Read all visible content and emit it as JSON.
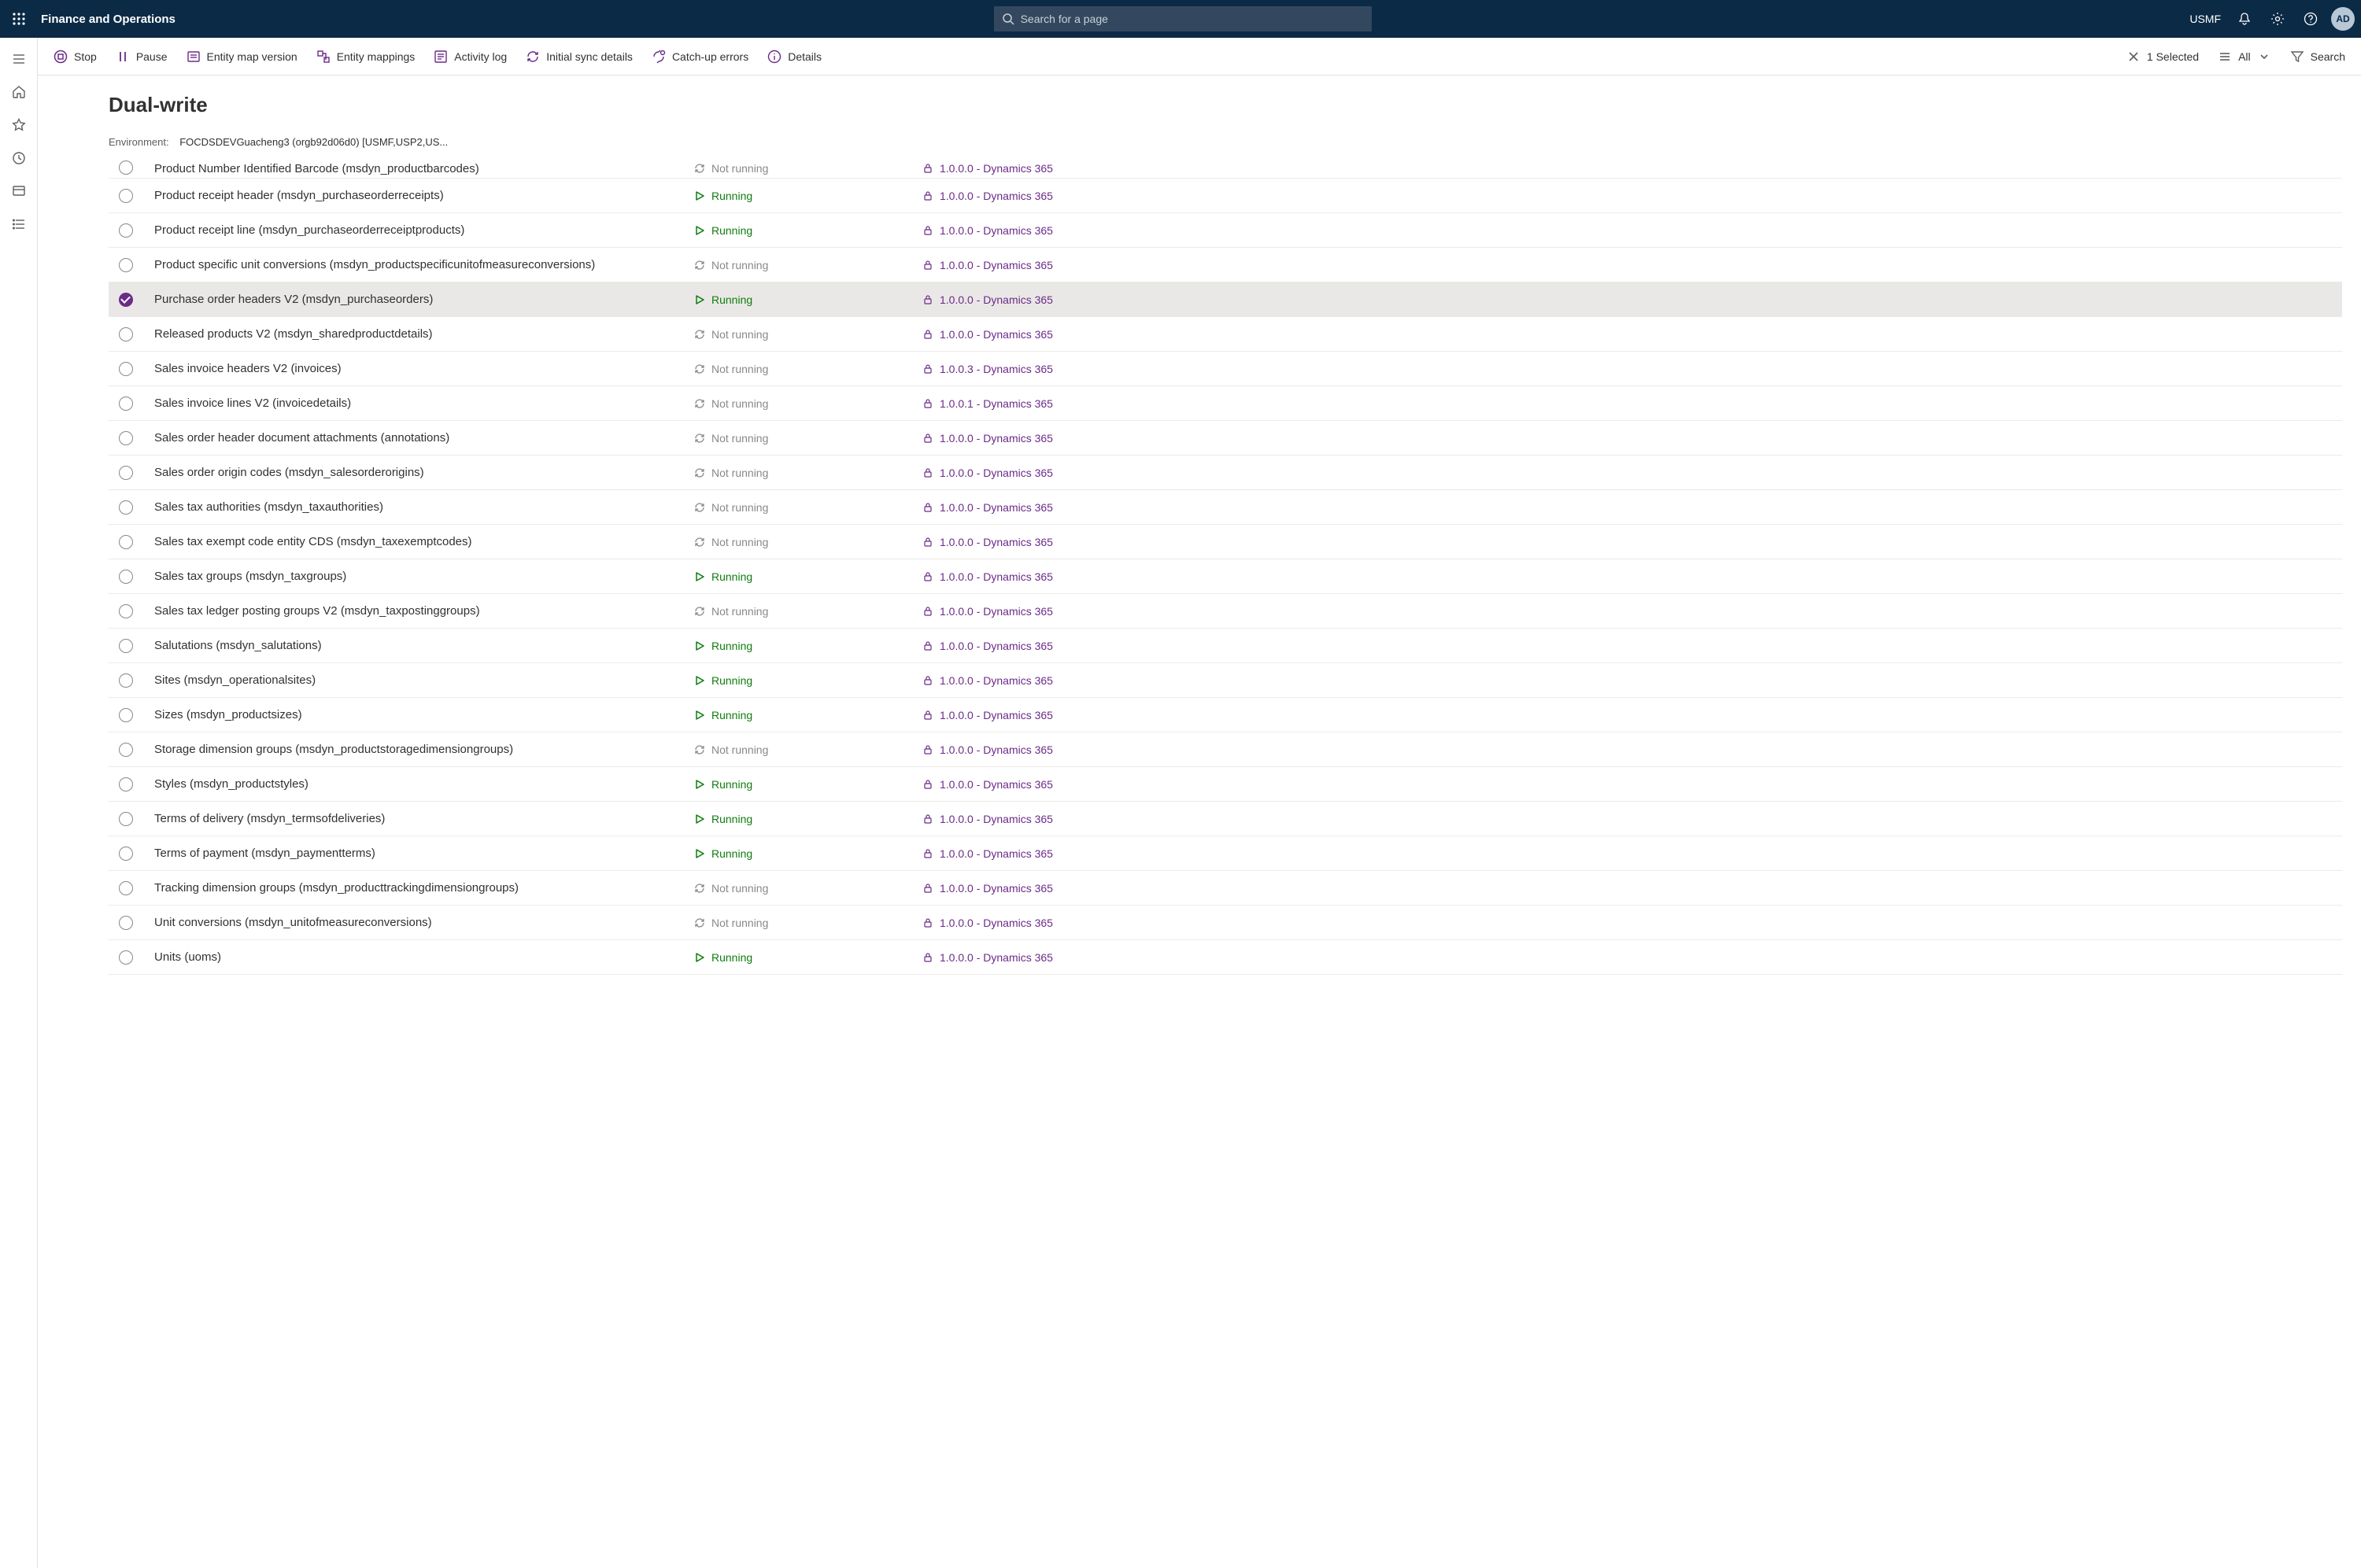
{
  "topbar": {
    "app_title": "Finance and Operations",
    "search_placeholder": "Search for a page",
    "company": "USMF",
    "avatar_initials": "AD"
  },
  "commands": {
    "stop": "Stop",
    "pause": "Pause",
    "entity_map_version": "Entity map version",
    "entity_mappings": "Entity mappings",
    "activity_log": "Activity log",
    "initial_sync_details": "Initial sync details",
    "catchup_errors": "Catch-up errors",
    "details": "Details",
    "selected": "1 Selected",
    "all": "All",
    "search": "Search"
  },
  "page": {
    "title": "Dual-write",
    "env_label": "Environment:",
    "env_value": "FOCDSDEVGuacheng3 (orgb92d06d0) [USMF,USP2,US..."
  },
  "status_labels": {
    "running": "Running",
    "notrunning": "Not running"
  },
  "rows": [
    {
      "name": "Product Number Identified Barcode (msdyn_productbarcodes)",
      "status": "notrunning",
      "version": "1.0.0.0 - Dynamics 365",
      "selected": false,
      "clipped": true
    },
    {
      "name": "Product receipt header (msdyn_purchaseorderreceipts)",
      "status": "running",
      "version": "1.0.0.0 - Dynamics 365",
      "selected": false
    },
    {
      "name": "Product receipt line (msdyn_purchaseorderreceiptproducts)",
      "status": "running",
      "version": "1.0.0.0 - Dynamics 365",
      "selected": false
    },
    {
      "name": "Product specific unit conversions (msdyn_productspecificunitofmeasureconversions)",
      "status": "notrunning",
      "version": "1.0.0.0 - Dynamics 365",
      "selected": false
    },
    {
      "name": "Purchase order headers V2 (msdyn_purchaseorders)",
      "status": "running",
      "version": "1.0.0.0 - Dynamics 365",
      "selected": true
    },
    {
      "name": "Released products V2 (msdyn_sharedproductdetails)",
      "status": "notrunning",
      "version": "1.0.0.0 - Dynamics 365",
      "selected": false
    },
    {
      "name": "Sales invoice headers V2 (invoices)",
      "status": "notrunning",
      "version": "1.0.0.3 - Dynamics 365",
      "selected": false
    },
    {
      "name": "Sales invoice lines V2 (invoicedetails)",
      "status": "notrunning",
      "version": "1.0.0.1 - Dynamics 365",
      "selected": false
    },
    {
      "name": "Sales order header document attachments (annotations)",
      "status": "notrunning",
      "version": "1.0.0.0 - Dynamics 365",
      "selected": false
    },
    {
      "name": "Sales order origin codes (msdyn_salesorderorigins)",
      "status": "notrunning",
      "version": "1.0.0.0 - Dynamics 365",
      "selected": false
    },
    {
      "name": "Sales tax authorities (msdyn_taxauthorities)",
      "status": "notrunning",
      "version": "1.0.0.0 - Dynamics 365",
      "selected": false
    },
    {
      "name": "Sales tax exempt code entity CDS (msdyn_taxexemptcodes)",
      "status": "notrunning",
      "version": "1.0.0.0 - Dynamics 365",
      "selected": false
    },
    {
      "name": "Sales tax groups (msdyn_taxgroups)",
      "status": "running",
      "version": "1.0.0.0 - Dynamics 365",
      "selected": false
    },
    {
      "name": "Sales tax ledger posting groups V2 (msdyn_taxpostinggroups)",
      "status": "notrunning",
      "version": "1.0.0.0 - Dynamics 365",
      "selected": false
    },
    {
      "name": "Salutations (msdyn_salutations)",
      "status": "running",
      "version": "1.0.0.0 - Dynamics 365",
      "selected": false
    },
    {
      "name": "Sites (msdyn_operationalsites)",
      "status": "running",
      "version": "1.0.0.0 - Dynamics 365",
      "selected": false
    },
    {
      "name": "Sizes (msdyn_productsizes)",
      "status": "running",
      "version": "1.0.0.0 - Dynamics 365",
      "selected": false
    },
    {
      "name": "Storage dimension groups (msdyn_productstoragedimensiongroups)",
      "status": "notrunning",
      "version": "1.0.0.0 - Dynamics 365",
      "selected": false
    },
    {
      "name": "Styles (msdyn_productstyles)",
      "status": "running",
      "version": "1.0.0.0 - Dynamics 365",
      "selected": false
    },
    {
      "name": "Terms of delivery (msdyn_termsofdeliveries)",
      "status": "running",
      "version": "1.0.0.0 - Dynamics 365",
      "selected": false
    },
    {
      "name": "Terms of payment (msdyn_paymentterms)",
      "status": "running",
      "version": "1.0.0.0 - Dynamics 365",
      "selected": false
    },
    {
      "name": "Tracking dimension groups (msdyn_producttrackingdimensiongroups)",
      "status": "notrunning",
      "version": "1.0.0.0 - Dynamics 365",
      "selected": false
    },
    {
      "name": "Unit conversions (msdyn_unitofmeasureconversions)",
      "status": "notrunning",
      "version": "1.0.0.0 - Dynamics 365",
      "selected": false
    },
    {
      "name": "Units (uoms)",
      "status": "running",
      "version": "1.0.0.0 - Dynamics 365",
      "selected": false
    }
  ]
}
